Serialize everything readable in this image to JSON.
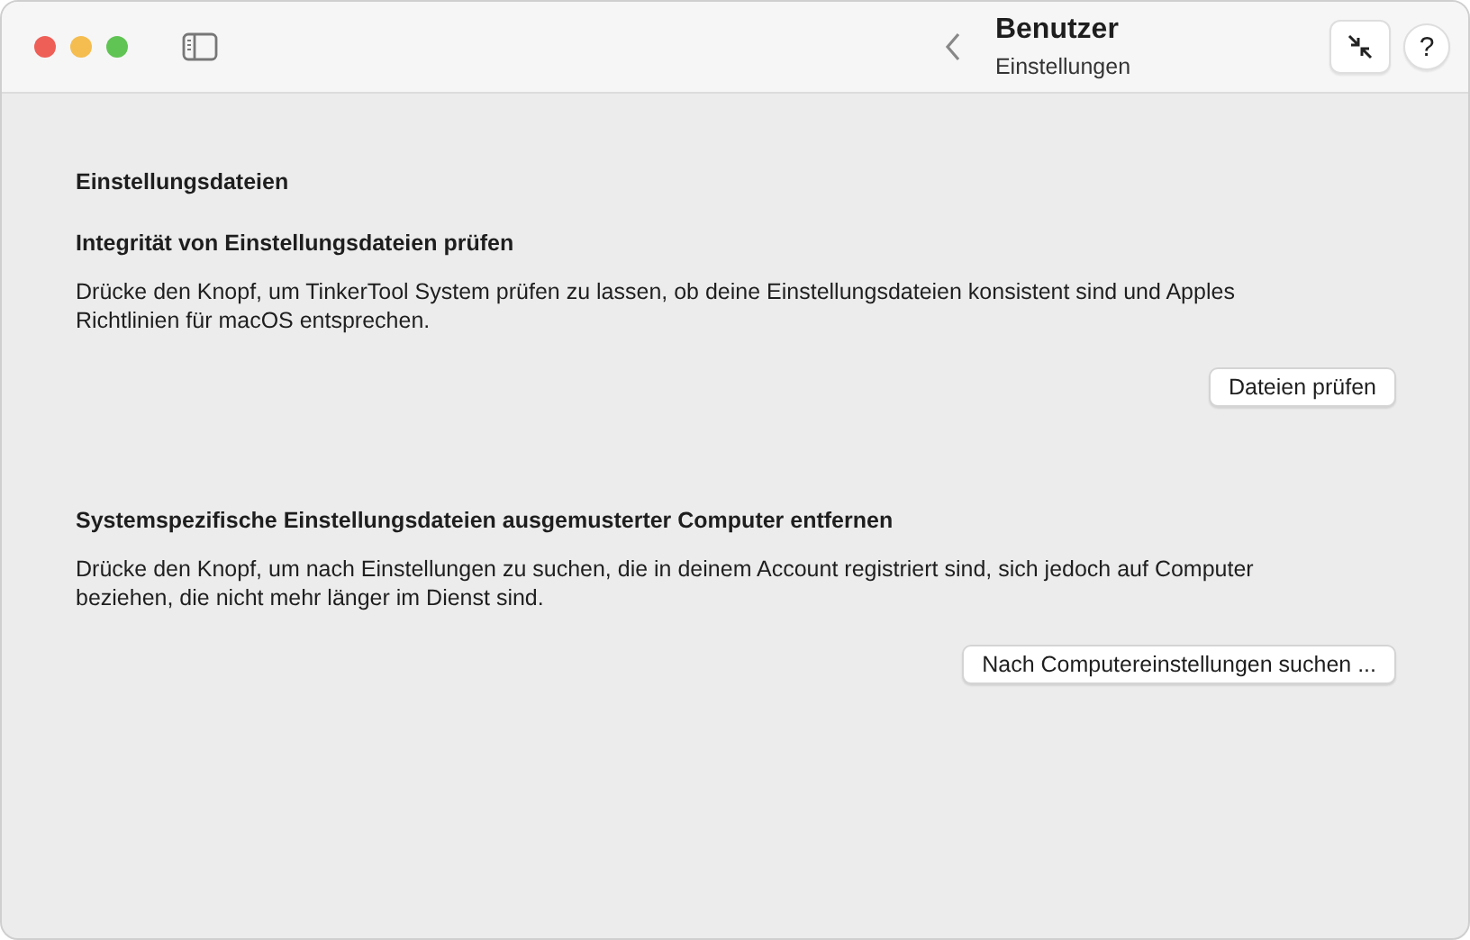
{
  "window": {
    "title": "Benutzer",
    "subtitle": "Einstellungen",
    "help": "?"
  },
  "section_title": "Einstellungsdateien",
  "groups": [
    {
      "heading": "Integrität von Einstellungsdateien prüfen",
      "text": "Drücke den Knopf, um TinkerTool System prüfen zu lassen, ob deine Einstellungsdateien konsistent sind und Apples Richtlinien für macOS entsprechen.",
      "button": "Dateien prüfen"
    },
    {
      "heading": "Systemspezifische Einstellungsdateien ausgemusterter Computer entfernen",
      "text": "Drücke den Knopf, um nach Einstellungen zu suchen, die in deinem Account registriert sind, sich jedoch auf Computer beziehen, die nicht mehr länger im Dienst sind.",
      "button": "Nach Computereinstellungen suchen ..."
    }
  ]
}
